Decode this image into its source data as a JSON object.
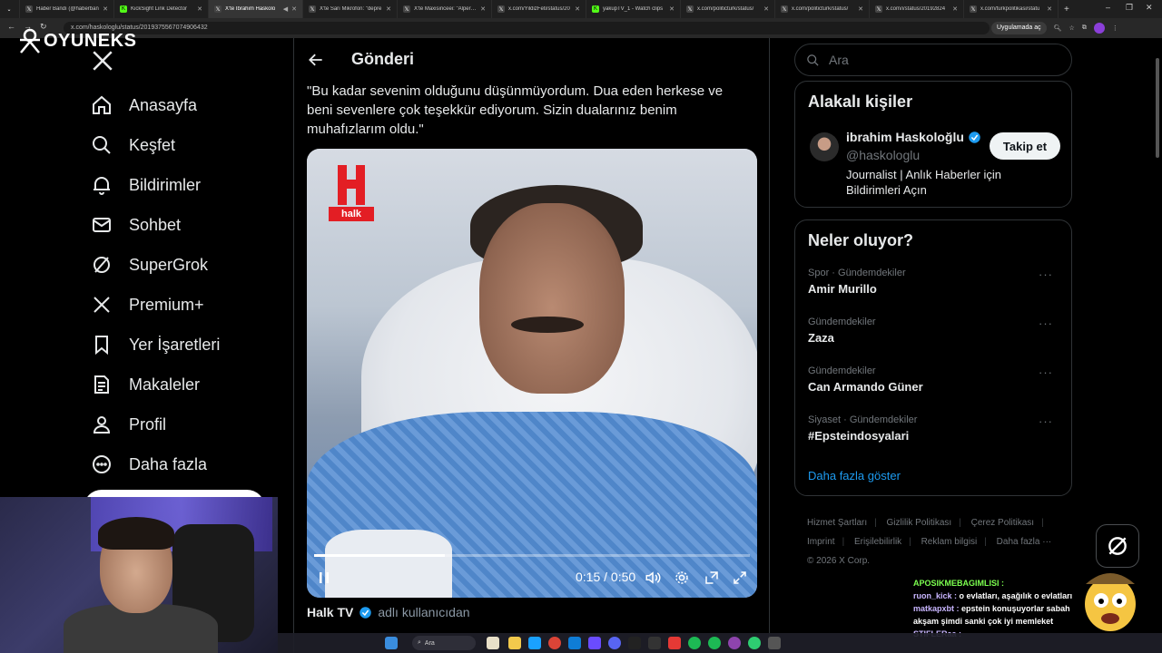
{
  "browser": {
    "tabs": [
      {
        "label": "Haber Bandı (@haberban",
        "active": false
      },
      {
        "label": "KickSight Link Detector",
        "active": false
      },
      {
        "label": "X'te İbrahim Haskolo",
        "active": true
      },
      {
        "label": "X'te Sarı Mikrofon: \"depre",
        "active": false
      },
      {
        "label": "X'te Maxisinceei: \"Alperen",
        "active": false
      },
      {
        "label": "x.com/YildizFeti/status/20",
        "active": false
      },
      {
        "label": "yakupTV_1 - Watch clips",
        "active": false
      },
      {
        "label": "x.com/politicturk/status/",
        "active": false
      },
      {
        "label": "x.com/politicturk/status/",
        "active": false
      },
      {
        "label": "x.com/i/status/20192824",
        "active": false
      },
      {
        "label": "x.com/turkpolitikasi/statu",
        "active": false
      }
    ],
    "url": "x.com/haskologlu/status/2019375567074906432",
    "app_badge": "Uygulamada aç"
  },
  "overlay_logo": "OYUNEKS",
  "nav": {
    "items": [
      {
        "label": "Anasayfa",
        "icon": "home-icon"
      },
      {
        "label": "Keşfet",
        "icon": "search-icon"
      },
      {
        "label": "Bildirimler",
        "icon": "bell-icon"
      },
      {
        "label": "Sohbet",
        "icon": "mail-icon"
      },
      {
        "label": "SuperGrok",
        "icon": "grok-icon"
      },
      {
        "label": "Premium+",
        "icon": "x-icon"
      },
      {
        "label": "Yer İşaretleri",
        "icon": "bookmark-icon"
      },
      {
        "label": "Makaleler",
        "icon": "article-icon"
      },
      {
        "label": "Profil",
        "icon": "profile-icon"
      },
      {
        "label": "Daha fazla",
        "icon": "more-icon"
      }
    ]
  },
  "main": {
    "title": "Gönderi",
    "post_text": "\"Bu kadar sevenim olduğunu düşünmüyordum. Dua eden herkese ve beni sevenlere çok teşekkür ediyorum.  Sizin dualarınız benim muhafızlarım oldu.\"",
    "video": {
      "logo_text": "halk",
      "time": "0:15 / 0:50",
      "progress": 0.3
    },
    "credit_name": "Halk TV",
    "credit_rest": "adlı kullanıcıdan"
  },
  "search": {
    "placeholder": "Ara"
  },
  "related": {
    "title": "Alakalı kişiler",
    "name": "ibrahim Haskoloğlu",
    "handle": "@haskologlu",
    "bio": "Journalist | Anlık Haberler için Bildirimleri Açın",
    "follow_label": "Takip et"
  },
  "trends": {
    "title": "Neler oluyor?",
    "items": [
      {
        "category": "Spor · Gündemdekiler",
        "topic": "Amir Murillo"
      },
      {
        "category": "Gündemdekiler",
        "topic": "Zaza"
      },
      {
        "category": "Gündemdekiler",
        "topic": "Can Armando Güner"
      },
      {
        "category": "Siyaset · Gündemdekiler",
        "topic": "#Epsteindosyalari"
      }
    ],
    "more_glyph": "···",
    "show_more": "Daha fazla göster"
  },
  "footer": {
    "links": [
      "Hizmet Şartları",
      "Gizlilik Politikası",
      "Çerez Politikası",
      "Imprint",
      "Erişilebilirlik",
      "Reklam bilgisi",
      "Daha fazla ···"
    ],
    "copyright": "© 2026 X Corp."
  },
  "chat": [
    {
      "user": "APOSIKMEBAGIMLISI :",
      "text": "",
      "color": "#7cff4f"
    },
    {
      "user": "ruon_kick :",
      "text": "o evlatları, aşağılık o evlatları",
      "color": "#c9b6ff"
    },
    {
      "user": "matkapxbt :",
      "text": "epstein konuşuyorlar sabah akşam şimdi sanki çok iyi memleket",
      "color": "#c9b6ff"
    },
    {
      "user": "STIFLERaa :",
      "text": "",
      "color": "#c9b6ff"
    }
  ],
  "taskbar": {
    "search_placeholder": "Ara"
  },
  "colors": {
    "accent": "#1d9bf0",
    "background": "#000000",
    "border": "#2f3336",
    "muted": "#71767b"
  }
}
